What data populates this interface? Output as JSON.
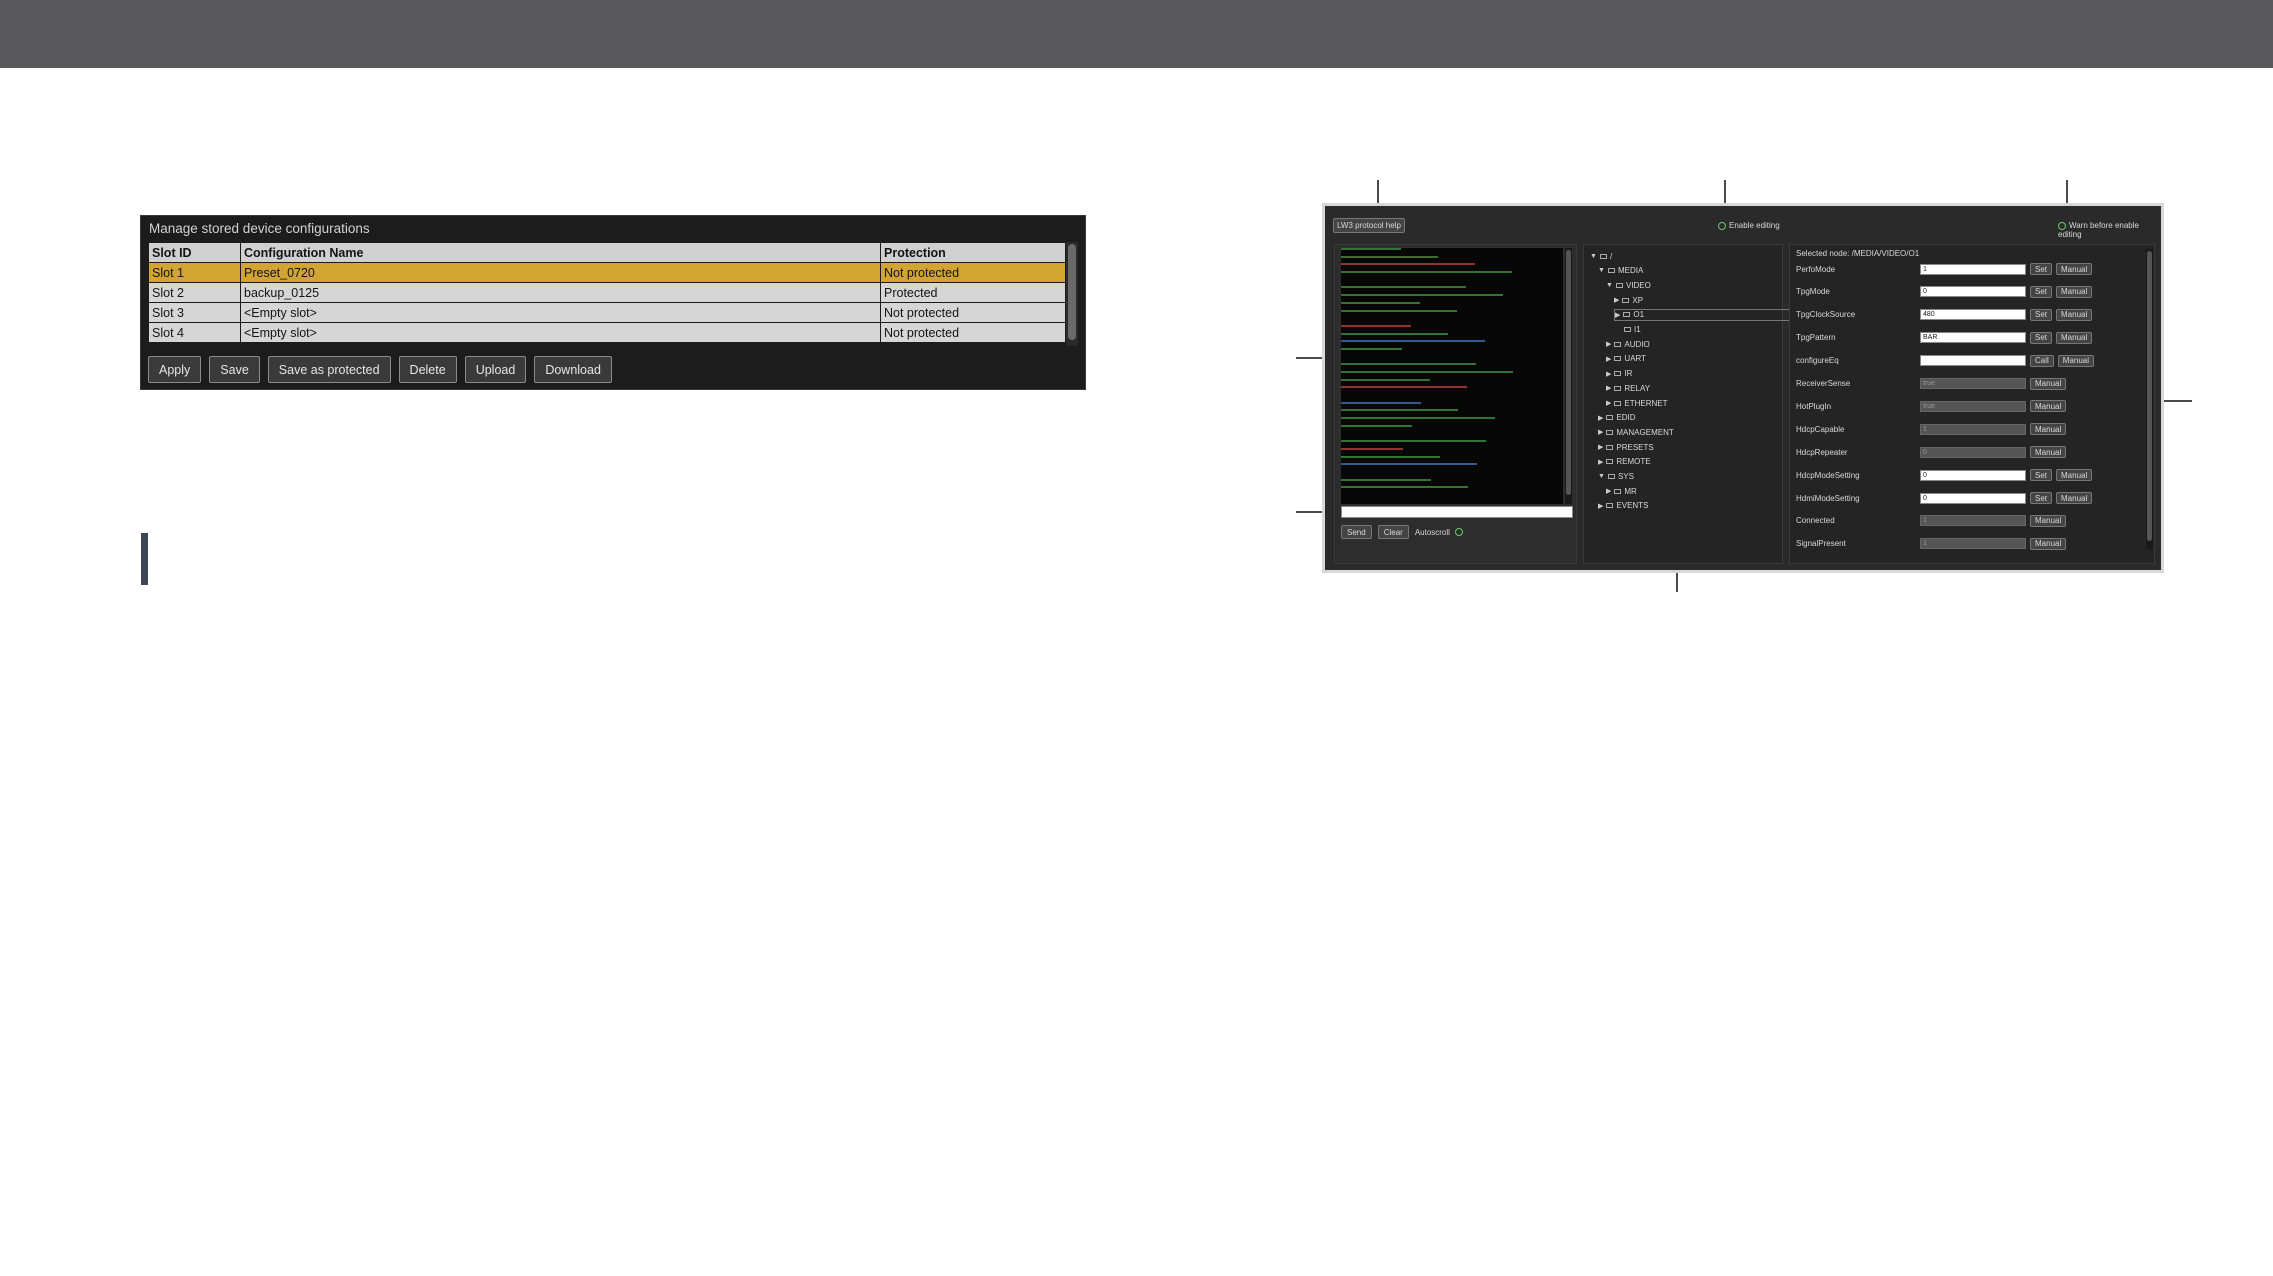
{
  "config_panel": {
    "title": "Manage stored device configurations",
    "columns": [
      "Slot ID",
      "Configuration Name",
      "Protection"
    ],
    "rows": [
      {
        "slot": "Slot 1",
        "name": "Preset_0720",
        "protection": "Not protected"
      },
      {
        "slot": "Slot 2",
        "name": "backup_0125",
        "protection": "Protected"
      },
      {
        "slot": "Slot 3",
        "name": "<Empty slot>",
        "protection": "Not protected"
      },
      {
        "slot": "Slot 4",
        "name": "<Empty slot>",
        "protection": "Not protected"
      }
    ],
    "selected_row": 0,
    "buttons": [
      "Apply",
      "Save",
      "Save as protected",
      "Delete",
      "Upload",
      "Download"
    ]
  },
  "lw3": {
    "protocol_help_label": "LW3 protocol help",
    "enable_editing_label": "Enable editing",
    "warn_label": "Warn before enable editing",
    "send_label": "Send",
    "clear_label": "Clear",
    "autoscroll_label": "Autoscroll",
    "tree": [
      {
        "label": "/",
        "level": 0,
        "open": true
      },
      {
        "label": "MEDIA",
        "level": 1,
        "open": true
      },
      {
        "label": "VIDEO",
        "level": 2,
        "open": true
      },
      {
        "label": "XP",
        "level": 3,
        "open": false
      },
      {
        "label": "O1",
        "level": 3,
        "open": false,
        "selected": true
      },
      {
        "label": "I1",
        "level": 3,
        "open": null
      },
      {
        "label": "AUDIO",
        "level": 2,
        "open": false
      },
      {
        "label": "UART",
        "level": 2,
        "open": false
      },
      {
        "label": "IR",
        "level": 2,
        "open": false
      },
      {
        "label": "RELAY",
        "level": 2,
        "open": false
      },
      {
        "label": "ETHERNET",
        "level": 2,
        "open": false
      },
      {
        "label": "EDID",
        "level": 1,
        "open": false
      },
      {
        "label": "MANAGEMENT",
        "level": 1,
        "open": false
      },
      {
        "label": "PRESETS",
        "level": 1,
        "open": false
      },
      {
        "label": "REMOTE",
        "level": 1,
        "open": false
      },
      {
        "label": "SYS",
        "level": 1,
        "open": true
      },
      {
        "label": "MR",
        "level": 2,
        "open": false
      },
      {
        "label": "EVENTS",
        "level": 1,
        "open": false
      }
    ],
    "selected_node_label": "Selected node: /MEDIA/VIDEO/O1",
    "properties": [
      {
        "name": "PerfoMode",
        "value": "1",
        "readonly": false,
        "buttons": [
          "Set",
          "Manual"
        ]
      },
      {
        "name": "TpgMode",
        "value": "0",
        "readonly": false,
        "buttons": [
          "Set",
          "Manual"
        ]
      },
      {
        "name": "TpgClockSource",
        "value": "480",
        "readonly": false,
        "buttons": [
          "Set",
          "Manual"
        ]
      },
      {
        "name": "TpgPattern",
        "value": "BAR",
        "readonly": false,
        "buttons": [
          "Set",
          "Manual"
        ]
      },
      {
        "name": "configureEq",
        "value": "",
        "readonly": false,
        "buttons": [
          "Call",
          "Manual"
        ]
      },
      {
        "name": "ReceiverSense",
        "value": "true",
        "readonly": true,
        "buttons": [
          "Manual"
        ]
      },
      {
        "name": "HotPlugIn",
        "value": "true",
        "readonly": true,
        "buttons": [
          "Manual"
        ]
      },
      {
        "name": "HdcpCapable",
        "value": "1",
        "readonly": true,
        "buttons": [
          "Manual"
        ]
      },
      {
        "name": "HdcpRepeater",
        "value": "0",
        "readonly": true,
        "buttons": [
          "Manual"
        ]
      },
      {
        "name": "HdcpModeSetting",
        "value": "0",
        "readonly": false,
        "buttons": [
          "Set",
          "Manual"
        ]
      },
      {
        "name": "HdmiModeSetting",
        "value": "0",
        "readonly": false,
        "buttons": [
          "Set",
          "Manual"
        ]
      },
      {
        "name": "Connected",
        "value": "1",
        "readonly": true,
        "buttons": [
          "Manual"
        ]
      },
      {
        "name": "SignalPresent",
        "value": "1",
        "readonly": true,
        "buttons": [
          "Manual"
        ]
      }
    ]
  }
}
